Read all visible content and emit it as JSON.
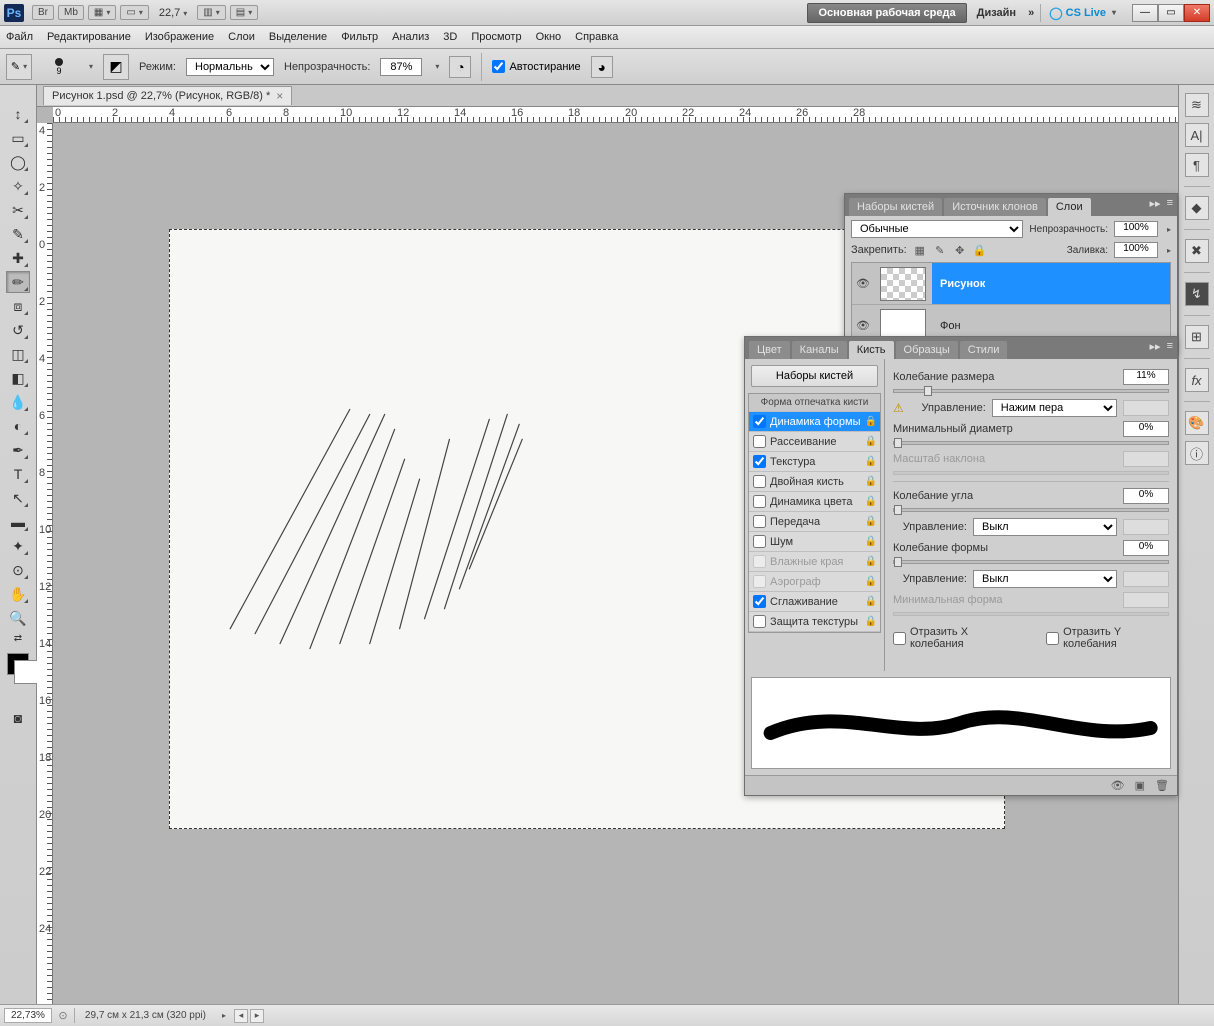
{
  "app": {
    "logo": "Ps",
    "zoom_value": "22,7"
  },
  "topbar_chips": {
    "br": "Br",
    "mb": "Mb"
  },
  "workspace": {
    "main": "Основная рабочая среда",
    "design": "Дизайн",
    "more": "»",
    "cslive": "CS Live"
  },
  "window_btns": {
    "min": "—",
    "max": "▭",
    "close": "✕"
  },
  "menu": [
    "Файл",
    "Редактирование",
    "Изображение",
    "Слои",
    "Выделение",
    "Фильтр",
    "Анализ",
    "3D",
    "Просмотр",
    "Окно",
    "Справка"
  ],
  "options": {
    "tool_icon": "✎",
    "brush_size": "9",
    "mode_label": "Режим:",
    "mode_value": "Нормальный",
    "opacity_label": "Непрозрачность:",
    "opacity_value": "87%",
    "auto_erase": "Автостирание"
  },
  "document": {
    "tab_title": "Рисунок 1.psd @ 22,7% (Рисунок, RGB/8) *"
  },
  "ruler_top": [
    "0",
    "2",
    "4",
    "6",
    "8",
    "10",
    "12",
    "14",
    "16",
    "18",
    "20",
    "22",
    "24",
    "26",
    "28"
  ],
  "ruler_left": [
    "4",
    "2",
    "0",
    "2",
    "4",
    "6",
    "8",
    "10",
    "12",
    "14",
    "16",
    "18",
    "20",
    "22",
    "24"
  ],
  "layers_panel": {
    "tabs": [
      "Наборы кистей",
      "Источник клонов",
      "Слои"
    ],
    "blend_mode": "Обычные",
    "opacity_label": "Непрозрачность:",
    "opacity_value": "100%",
    "lock_label": "Закрепить:",
    "fill_label": "Заливка:",
    "fill_value": "100%",
    "layers": [
      {
        "name": "Рисунок",
        "selected": true,
        "checker": true
      },
      {
        "name": "Фон",
        "selected": false,
        "checker": false
      }
    ]
  },
  "brush_panel": {
    "tabs": [
      "Цвет",
      "Каналы",
      "Кисть",
      "Образцы",
      "Стили"
    ],
    "presets_btn": "Наборы кистей",
    "list_header": "Форма отпечатка кисти",
    "options": [
      {
        "label": "Динамика формы",
        "checked": true,
        "selected": true,
        "disabled": false
      },
      {
        "label": "Рассеивание",
        "checked": false,
        "selected": false,
        "disabled": false
      },
      {
        "label": "Текстура",
        "checked": true,
        "selected": false,
        "disabled": false
      },
      {
        "label": "Двойная кисть",
        "checked": false,
        "selected": false,
        "disabled": false
      },
      {
        "label": "Динамика цвета",
        "checked": false,
        "selected": false,
        "disabled": false
      },
      {
        "label": "Передача",
        "checked": false,
        "selected": false,
        "disabled": false
      },
      {
        "label": "Шум",
        "checked": false,
        "selected": false,
        "disabled": false
      },
      {
        "label": "Влажные края",
        "checked": false,
        "selected": false,
        "disabled": true
      },
      {
        "label": "Аэрограф",
        "checked": false,
        "selected": false,
        "disabled": true
      },
      {
        "label": "Сглаживание",
        "checked": true,
        "selected": false,
        "disabled": false
      },
      {
        "label": "Защита текстуры",
        "checked": false,
        "selected": false,
        "disabled": false
      }
    ],
    "ctrls": {
      "size_jitter": "Колебание размера",
      "size_jitter_val": "11%",
      "control_label": "Управление:",
      "control_pen": "Нажим пера",
      "min_diam": "Минимальный диаметр",
      "min_diam_val": "0%",
      "tilt_scale": "Масштаб наклона",
      "angle_jitter": "Колебание угла",
      "angle_jitter_val": "0%",
      "ctrl_off": "Выкл",
      "round_jitter": "Колебание формы",
      "round_jitter_val": "0%",
      "min_round": "Минимальная форма",
      "flip_x": "Отразить X колебания",
      "flip_y": "Отразить Y колебания"
    }
  },
  "statusbar": {
    "zoom": "22,73%",
    "doc_info": "29,7 см x 21,3 см (320 ppi)"
  }
}
